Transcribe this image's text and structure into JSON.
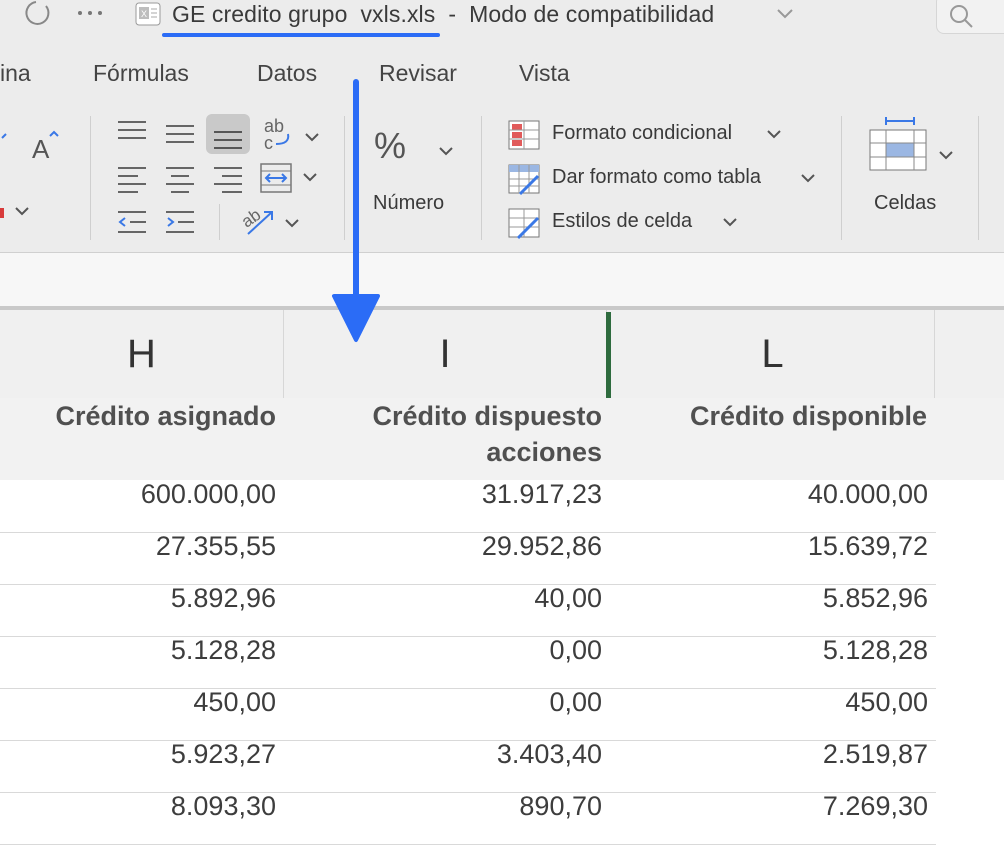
{
  "titlebar": {
    "file_name": "GE credito grupo  vxls.xls",
    "separator": "-",
    "mode": "Modo de compatibilidad",
    "file_icon": "excel-file-icon",
    "refresh_icon": "refresh-icon",
    "more_icon": "more-icon",
    "search_icon": "search-icon",
    "accent_color": "#2b6cf6"
  },
  "ribbon_tabs": [
    "ina",
    "Fórmulas",
    "Datos",
    "Revisar",
    "Vista"
  ],
  "ribbon": {
    "number_label": "Número",
    "styles": {
      "conditional": "Formato condicional",
      "table": "Dar formato como tabla",
      "cell_styles": "Estilos de celda"
    },
    "cells_label": "Celdas"
  },
  "columns": [
    "H",
    "I",
    "L"
  ],
  "header_row": {
    "h": "Crédito asignado",
    "i_line1": "Crédito dispuesto",
    "i_line2": "acciones",
    "l": "Crédito disponible"
  },
  "rows": [
    {
      "h": "600.000,00",
      "i": "31.917,23",
      "l": "40.000,00"
    },
    {
      "h": "27.355,55",
      "i": "29.952,86",
      "l": "15.639,72"
    },
    {
      "h": "5.892,96",
      "i": "40,00",
      "l": "5.852,96"
    },
    {
      "h": "5.128,28",
      "i": "0,00",
      "l": "5.128,28"
    },
    {
      "h": "450,00",
      "i": "0,00",
      "l": "450,00"
    },
    {
      "h": "5.923,27",
      "i": "3.403,40",
      "l": "2.519,87"
    },
    {
      "h": "8.093,30",
      "i": "890,70",
      "l": "7.269,30"
    }
  ],
  "colors": {
    "selected_column_border": "#2e6b3e",
    "annotation_arrow": "#2b6cf6"
  }
}
